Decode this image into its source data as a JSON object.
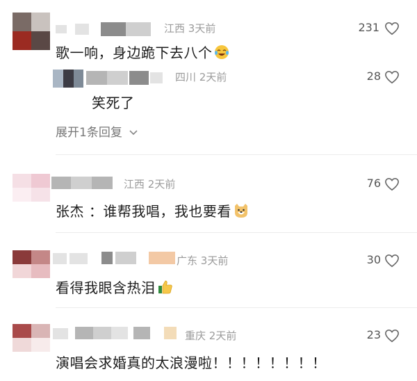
{
  "comments": [
    {
      "location": "江西",
      "time": "3天前",
      "text": "歌一响，身边跪下去八个",
      "likes": "231",
      "emoji": "laughing-crying-emoji"
    },
    {
      "location": "四川",
      "time": "2天前",
      "text": "笑死了",
      "likes": "28"
    },
    {
      "expand_label": "展开1条回复"
    },
    {
      "location": "江西",
      "time": "2天前",
      "text": "张杰 ：谁帮我唱，我也要看",
      "likes": "76",
      "emoji": "doge-emoji"
    },
    {
      "location": "广东",
      "time": "3天前",
      "text": "看得我眼含热泪",
      "likes": "30",
      "emoji": "thumbs-up-emoji"
    },
    {
      "location": "重庆",
      "time": "2天前",
      "text": "演唱会求婚真的太浪漫啦！！！！！！！！",
      "likes": "23"
    }
  ],
  "colors": {
    "text": "#1c1c1c",
    "meta": "#9a9a9a",
    "divider": "#ececec"
  }
}
